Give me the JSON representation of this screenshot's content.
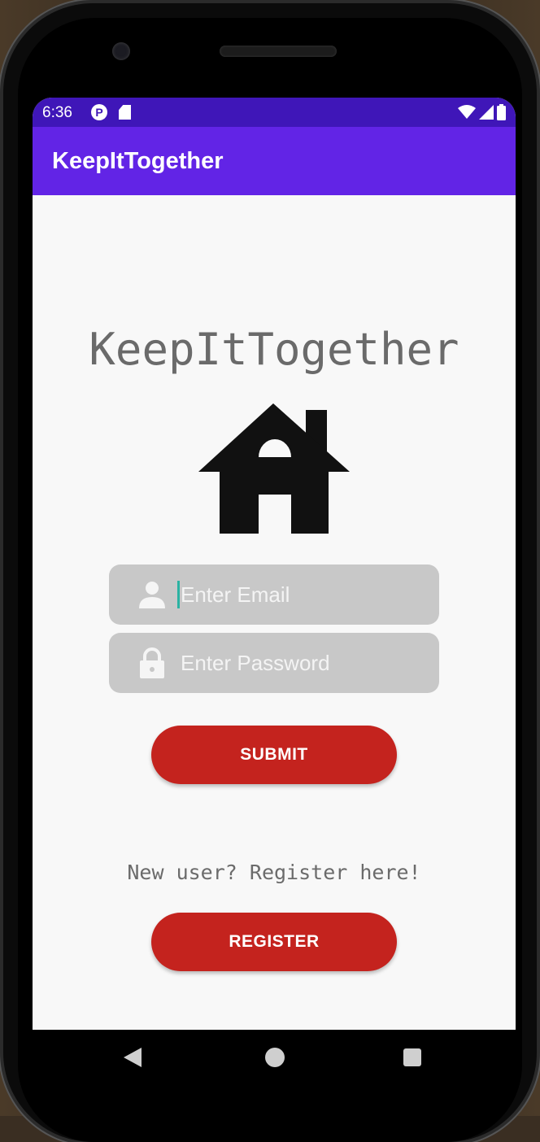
{
  "status_bar": {
    "time": "6:36",
    "icons": [
      "p-notification-icon",
      "sd-card-icon",
      "wifi-icon",
      "signal-icon",
      "battery-icon"
    ]
  },
  "app_bar": {
    "title": "KeepItTogether",
    "color": "#6224e6"
  },
  "main": {
    "brand_title": "KeepItTogether",
    "logo_icon": "house-icon",
    "email_field": {
      "placeholder": "Enter Email",
      "value": "",
      "icon": "person-icon"
    },
    "password_field": {
      "placeholder": "Enter Password",
      "value": "",
      "icon": "lock-icon"
    },
    "submit_label": "SUBMIT",
    "register_prompt": "New user? Register here!",
    "register_label": "REGISTER",
    "button_color": "#c4231e"
  },
  "nav_bar": {
    "icons": [
      "back-icon",
      "home-icon",
      "recents-icon"
    ]
  }
}
